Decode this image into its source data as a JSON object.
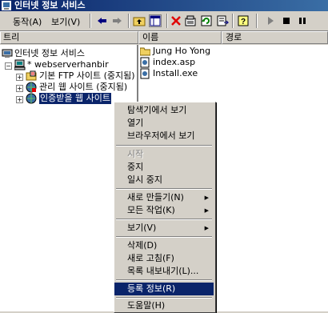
{
  "window": {
    "title": "인터넷 정보 서비스"
  },
  "menubar": {
    "action": "동작(A)",
    "view": "보기(V)"
  },
  "toolbar_icons": [
    "back-arrow-icon",
    "forward-arrow-icon",
    "up-folder-icon",
    "show-hide-tree-icon",
    "delete-icon",
    "properties-icon",
    "refresh-icon",
    "export-list-icon",
    "help-icon",
    "start-icon",
    "stop-icon",
    "pause-icon"
  ],
  "headers": {
    "tree": "트리",
    "name": "이름",
    "path": "경로"
  },
  "tree": [
    {
      "label": "인터넷 정보 서비스",
      "icon": "iis-icon"
    },
    {
      "label": "* webserverhanbir",
      "icon": "computer-icon"
    },
    {
      "label": "기본 FTP 사이트 (중지됨)",
      "icon": "ftp-site-icon"
    },
    {
      "label": "관리 웹 사이트 (중지됨)",
      "icon": "web-site-icon"
    },
    {
      "label": "인증받을 웹 사이트",
      "icon": "web-site-icon",
      "selected": true
    }
  ],
  "files": [
    {
      "name": "Jung Ho Yong",
      "icon": "folder-icon"
    },
    {
      "name": "index.asp",
      "icon": "file-icon"
    },
    {
      "name": "Install.exe",
      "icon": "file-icon"
    }
  ],
  "context_menu": {
    "explorer": "탐색기에서 보기",
    "open": "열기",
    "browse": "브라우저에서 보기",
    "start": "시작",
    "stop": "중지",
    "pause": "일시 중지",
    "new": "새로 만들기(N)",
    "all_tasks": "모든 작업(K)",
    "view": "보기(V)",
    "delete": "삭제(D)",
    "refresh": "새로 고침(F)",
    "export": "목록 내보내기(L)...",
    "properties": "등록 정보(R)",
    "help": "도움말(H)"
  },
  "colors": {
    "titlebar": "#0a246a",
    "face": "#d4d0c8",
    "highlight": "#0a246a"
  }
}
